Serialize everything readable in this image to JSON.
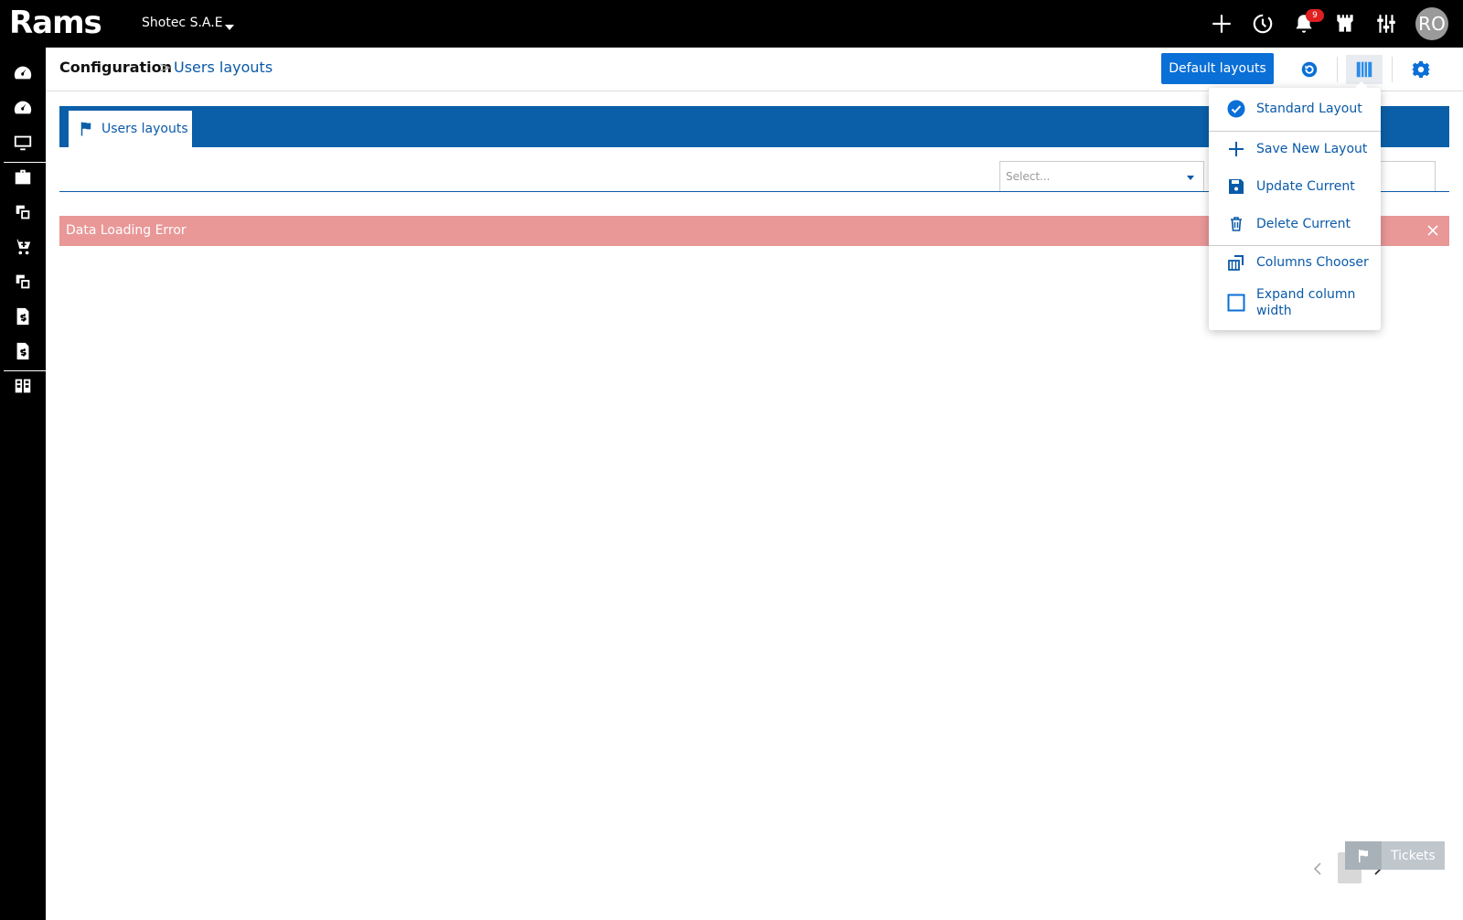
{
  "app": {
    "logo_text": "Rams",
    "company": "Shotec S.A.E",
    "notification_count": "9",
    "avatar_initials": "RO"
  },
  "icons": {
    "top": [
      "plus-icon",
      "history-icon",
      "bell-icon",
      "castle-icon",
      "sliders-icon"
    ],
    "sidebar": [
      "dashboard-icon",
      "dashboard-icon",
      "monitor-icon",
      "briefcase-icon",
      "modules-icon",
      "cart-icon",
      "modules-icon",
      "invoice-icon",
      "invoice-icon",
      "layout-icon"
    ]
  },
  "breadcrumb": {
    "root": "Configuration",
    "separator": ">",
    "current": "Users layouts"
  },
  "header": {
    "default_layouts_label": "Default layouts"
  },
  "tabs": [
    {
      "label": "Users layouts"
    }
  ],
  "filter": {
    "select_placeholder": "Select..."
  },
  "error": {
    "message": "Data Loading Error"
  },
  "layout_menu": {
    "items": [
      {
        "label": "Standard Layout",
        "icon": "check-circle-icon"
      },
      {
        "label": "Save New Layout",
        "icon": "plus-icon"
      },
      {
        "label": "Update Current",
        "icon": "save-icon"
      },
      {
        "label": "Delete Current",
        "icon": "trash-icon"
      },
      {
        "label": "Columns Chooser",
        "icon": "columns-icon"
      },
      {
        "label": "Expand column width",
        "icon": "checkbox-icon"
      }
    ]
  },
  "footer": {
    "tickets_label": "Tickets"
  },
  "colors": {
    "topbar": "#000000",
    "brand_blue": "#0a5fa8",
    "link_blue": "#0a5aa8",
    "button_blue": "#0a6fd6",
    "error_bg": "#e99797"
  }
}
